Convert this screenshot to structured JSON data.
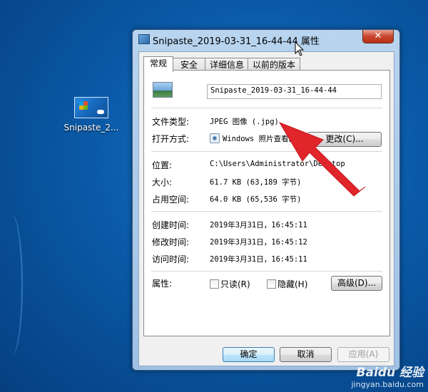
{
  "desktop": {
    "icon_label": "Snipaste_2..."
  },
  "window": {
    "title": "Snipaste_2019-03-31_16-44-44 属性",
    "close_glyph": "✕"
  },
  "tabs": [
    "常规",
    "安全",
    "详细信息",
    "以前的版本"
  ],
  "general": {
    "file_name": "Snipaste_2019-03-31_16-44-44",
    "file_type_label": "文件类型:",
    "file_type_value": "JPEG 图像 (.jpg)",
    "open_with_label": "打开方式:",
    "open_with_value": "Windows 照片查看器",
    "change_button": "更改(C)...",
    "location_label": "位置:",
    "location_value": "C:\\Users\\Administrator\\Desktop",
    "size_label": "大小:",
    "size_value": "61.7 KB (63,189 字节)",
    "size_on_disk_label": "占用空间:",
    "size_on_disk_value": "64.0 KB (65,536 字节)",
    "created_label": "创建时间:",
    "created_value": "2019年3月31日，16:45:11",
    "modified_label": "修改时间:",
    "modified_value": "2019年3月31日，16:45:12",
    "accessed_label": "访问时间:",
    "accessed_value": "2019年3月31日，16:45:11",
    "attributes_label": "属性:",
    "readonly_label": "只读(R)",
    "hidden_label": "隐藏(H)",
    "advanced_button": "高级(D)..."
  },
  "footer": {
    "ok": "确定",
    "cancel": "取消",
    "apply": "应用(A)"
  },
  "watermark": {
    "logo": "Baidu 经验",
    "url": "jingyan.baidu.com"
  },
  "colors": {
    "annotation_arrow": "#e0252b",
    "desktop": "#0a5aa8"
  },
  "icons": [
    "close-icon",
    "file-thumbnail-icon",
    "photo-viewer-icon",
    "red-annotation-arrow",
    "mouse-cursor-icon"
  ]
}
